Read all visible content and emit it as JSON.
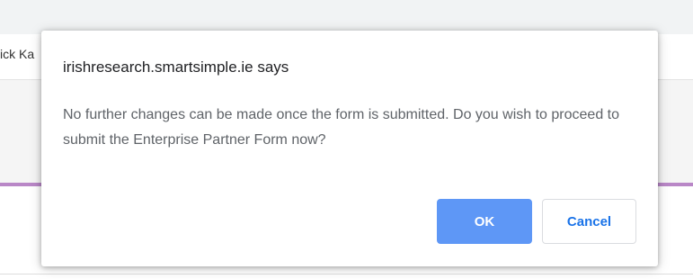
{
  "background": {
    "user_name_fragment": "ick Ka"
  },
  "dialog": {
    "title": "irishresearch.smartsimple.ie says",
    "message": "No further changes can be made once the form is submitted. Do you wish to proceed to submit the Enterprise Partner Form now?",
    "ok_label": "OK",
    "cancel_label": "Cancel"
  },
  "colors": {
    "accent": "#5e97f6",
    "cancel_text": "#1a73e8",
    "purple_rule": "#b987c7"
  }
}
